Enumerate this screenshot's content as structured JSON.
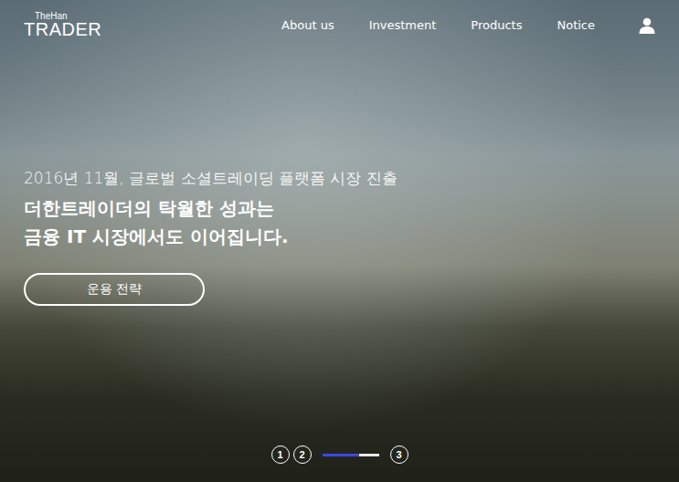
{
  "header": {
    "logo": {
      "top": "TheHan",
      "bottom": "TRADER"
    },
    "nav": [
      {
        "label": "About us"
      },
      {
        "label": "Investment"
      },
      {
        "label": "Products"
      },
      {
        "label": "Notice"
      }
    ]
  },
  "hero": {
    "subtitle": "2016년 11월, 글로벌 소셜트레이딩 플랫폼 시장 진출",
    "title_lines": [
      "더한트레이더의 탁월한 성과는",
      "금융 IT 시장에서도 이어집니다."
    ],
    "button": "운용 전략"
  },
  "pagination": {
    "before": [
      "1",
      "2"
    ],
    "progress": {
      "level": 0.65
    },
    "after": [
      "3"
    ]
  }
}
